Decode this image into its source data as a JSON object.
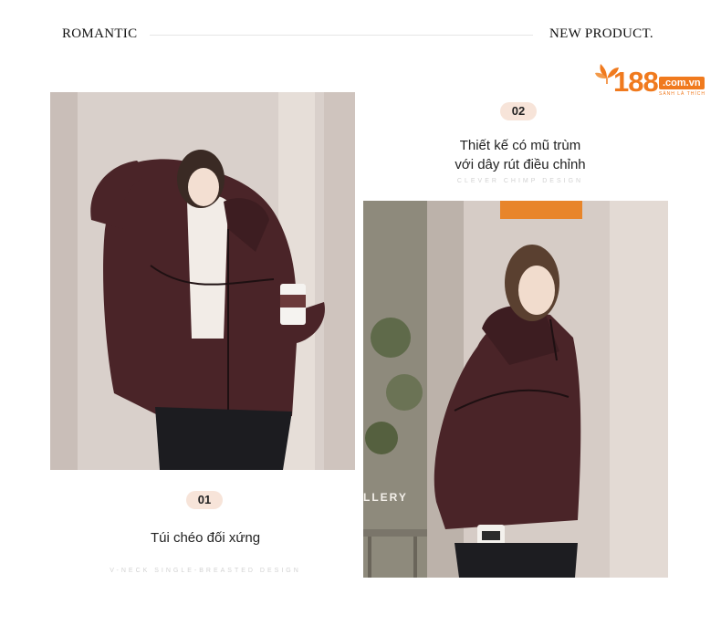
{
  "header": {
    "left": "ROMANTIC",
    "right": "NEW PRODUCT."
  },
  "logo": {
    "number": "188",
    "domain": ".com.vn",
    "tagline": "SÀNH LÀ THÍCH",
    "accent": "#f07a1e"
  },
  "features": [
    {
      "badge": "01",
      "caption": "Túi chéo đối xứng",
      "subline": "V-NECK SINGLE-BREASTED DESIGN"
    },
    {
      "badge": "02",
      "caption_line1": "Thiết kế có mũ trùm",
      "caption_line2": "với dây rút điều chỉnh",
      "subline": "CLEVER CHIMP DESIGN"
    }
  ],
  "photo2_sign": "LLERY",
  "colors": {
    "jacket": "#4a2428",
    "badge_bg": "#f7e4d9"
  }
}
